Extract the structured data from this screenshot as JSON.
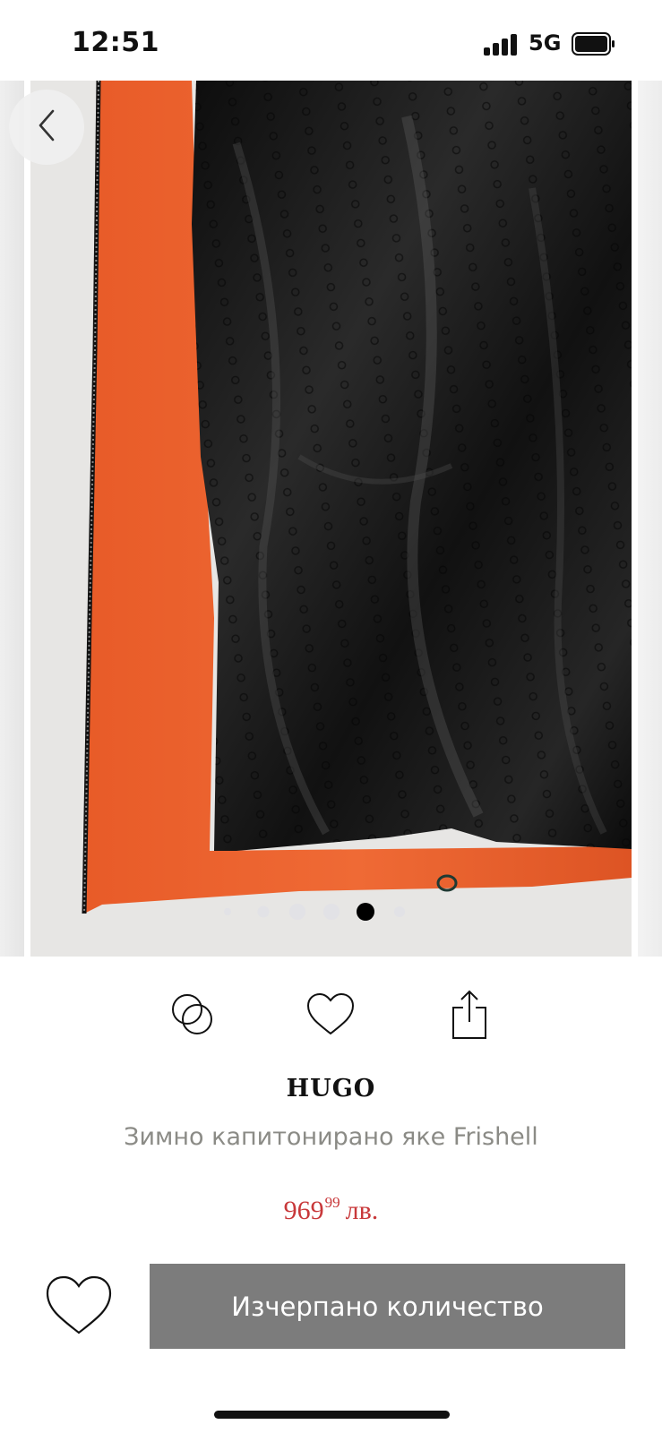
{
  "status_bar": {
    "time": "12:51",
    "network": "5G",
    "signal_icon": "cellular-signal-icon",
    "battery_icon": "battery-icon",
    "battery_level": 0.9
  },
  "gallery": {
    "image": "Product photo: inside of orange quilted jacket with black HUGO-monogram satin lining",
    "back_icon": "chevron-left-icon",
    "total_slides": 6,
    "active_slide": 5,
    "colors": {
      "shell": "#e45a2b",
      "lining": "#161616",
      "background": "#e7e6e4"
    }
  },
  "actions": [
    {
      "icon": "compare-icon"
    },
    {
      "icon": "heart-icon"
    },
    {
      "icon": "share-icon"
    }
  ],
  "product": {
    "brand": "HUGO",
    "name": "Зимно капитонирано яке Frishell",
    "price_main": "969",
    "price_cents": "99",
    "currency": "лв.",
    "price_color": "#c8383a"
  },
  "footer": {
    "wishlist_icon": "heart-icon",
    "cta_label": "Изчерпано количество",
    "cta_color": "#7c7c7c"
  }
}
